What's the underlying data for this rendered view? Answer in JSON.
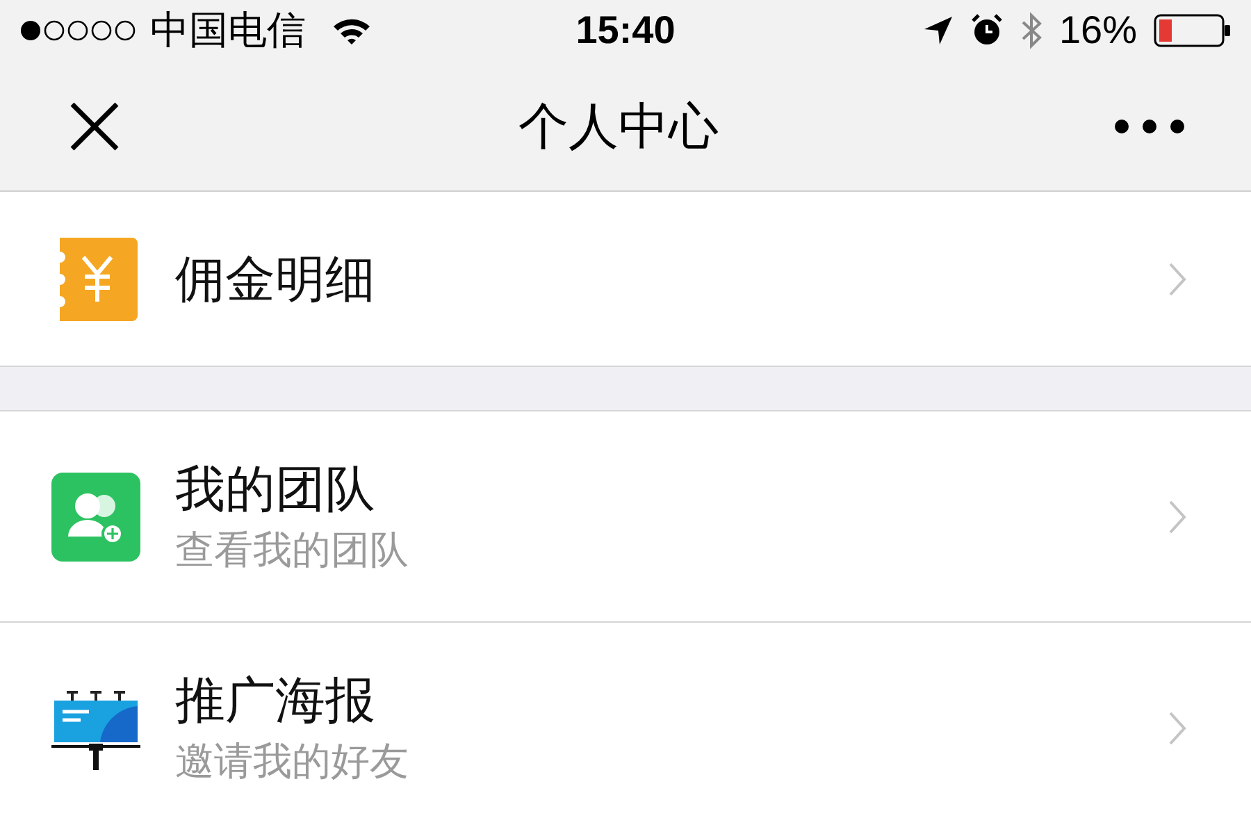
{
  "status_bar": {
    "carrier": "中国电信",
    "time": "15:40",
    "battery": "16%"
  },
  "nav_bar": {
    "title": "个人中心"
  },
  "groups": [
    {
      "items": [
        {
          "kind": "commission",
          "title": "佣金明细"
        }
      ]
    },
    {
      "items": [
        {
          "kind": "team",
          "title": "我的团队",
          "subtitle": "查看我的团队"
        },
        {
          "kind": "poster",
          "title": "推广海报",
          "subtitle": "邀请我的好友"
        }
      ]
    }
  ]
}
